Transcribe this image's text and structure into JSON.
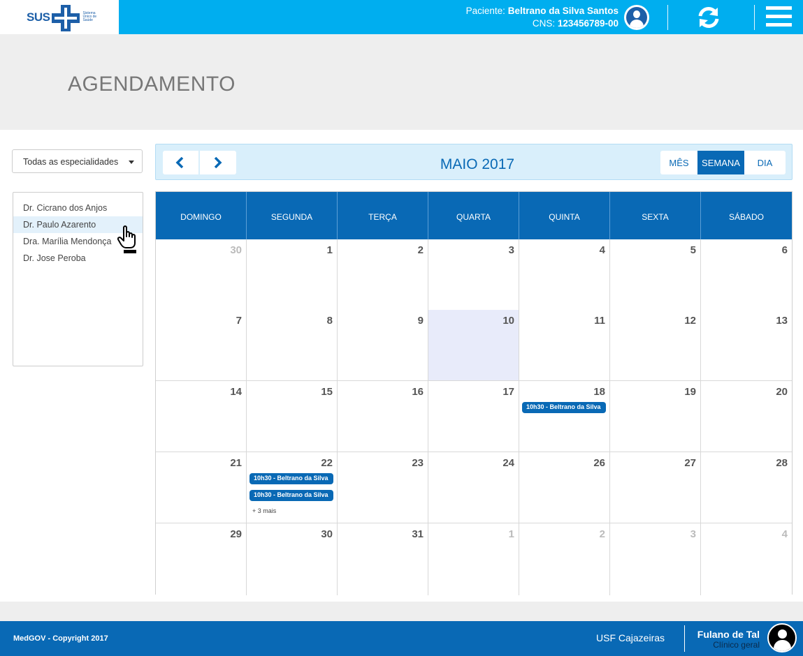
{
  "header": {
    "logo_text": "SUS",
    "logo_subtitle": "Sistema Único de Saúde",
    "patient_label": "Paciente:",
    "patient_name": "Beltrano da Silva Santos",
    "cns_label": "CNS:",
    "cns_value": "123456789-00",
    "icons": [
      "user-icon",
      "refresh-icon",
      "menu-icon"
    ]
  },
  "page": {
    "title": "AGENDAMENTO"
  },
  "sidebar": {
    "specialty_select": "Todas as especialidades",
    "doctors": [
      {
        "name": "Dr. Cicrano dos Anjos",
        "active": false
      },
      {
        "name": "Dr. Paulo Azarento",
        "active": true
      },
      {
        "name": "Dra. Marília Mendonça",
        "active": false
      },
      {
        "name": "Dr. Jose Peroba",
        "active": false
      }
    ]
  },
  "calendar": {
    "month_title": "MAIO 2017",
    "views": {
      "month": "MÊS",
      "week": "SEMANA",
      "day": "DIA"
    },
    "active_view": "SEMANA",
    "weekdays": [
      "DOMINGO",
      "SEGUNDA",
      "TERÇA",
      "QUARTA",
      "QUINTA",
      "SEXTA",
      "SÁBADO"
    ],
    "weeks": [
      [
        {
          "d": "30",
          "muted": true
        },
        {
          "d": "1"
        },
        {
          "d": "2"
        },
        {
          "d": "3"
        },
        {
          "d": "4"
        },
        {
          "d": "5"
        },
        {
          "d": "6"
        }
      ],
      [
        {
          "d": "7"
        },
        {
          "d": "8"
        },
        {
          "d": "9"
        },
        {
          "d": "10",
          "today": true
        },
        {
          "d": "11"
        },
        {
          "d": "12"
        },
        {
          "d": "13"
        }
      ],
      [
        {
          "d": "14"
        },
        {
          "d": "15"
        },
        {
          "d": "16"
        },
        {
          "d": "17"
        },
        {
          "d": "18",
          "events": [
            "10h30 - Beltrano da Silva"
          ]
        },
        {
          "d": "19"
        },
        {
          "d": "20"
        }
      ],
      [
        {
          "d": "21"
        },
        {
          "d": "22",
          "events": [
            "10h30 - Beltrano da Silva",
            "10h30 - Beltrano da Silva"
          ],
          "more": "+ 3 mais"
        },
        {
          "d": "23"
        },
        {
          "d": "24"
        },
        {
          "d": "26"
        },
        {
          "d": "27"
        },
        {
          "d": "28"
        }
      ],
      [
        {
          "d": "29"
        },
        {
          "d": "30"
        },
        {
          "d": "31"
        },
        {
          "d": "1",
          "muted": true
        },
        {
          "d": "2",
          "muted": true
        },
        {
          "d": "3",
          "muted": true
        },
        {
          "d": "4",
          "muted": true
        }
      ]
    ]
  },
  "footer": {
    "copyright": "MedGOV - Copyright 2017",
    "unit": "USF Cajazeiras",
    "user_name": "Fulano de Tal",
    "user_role": "Clínico geral"
  },
  "colors": {
    "header_bg": "#00aeef",
    "primary": "#0969b5",
    "today_bg": "#e8ebfa",
    "toolbar_bg": "#d9effb"
  }
}
